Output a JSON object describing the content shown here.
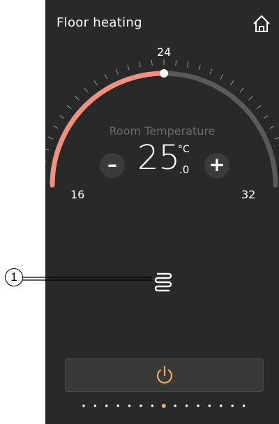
{
  "header": {
    "title": "Floor heating",
    "home_icon": "home-icon"
  },
  "dial": {
    "label": "Room Temperature",
    "value_int": "25",
    "unit": "°C",
    "value_dec": ".0",
    "scale_min": "16",
    "scale_mid": "24",
    "scale_max": "32",
    "setpoint": 24,
    "active_color": "#f09080",
    "inactive_color": "#5a5a5a"
  },
  "controls": {
    "minus_label": "–",
    "plus_label": "+"
  },
  "mode": {
    "icon": "floor-heating-icon"
  },
  "power": {
    "icon": "power-icon",
    "color": "#e8b060"
  },
  "pagination": {
    "count": 15,
    "active_index": 7
  },
  "annotation": {
    "callout_number": "1"
  },
  "colors": {
    "background": "#2a2929",
    "text": "#ffffff",
    "muted": "#6b6b6b"
  }
}
